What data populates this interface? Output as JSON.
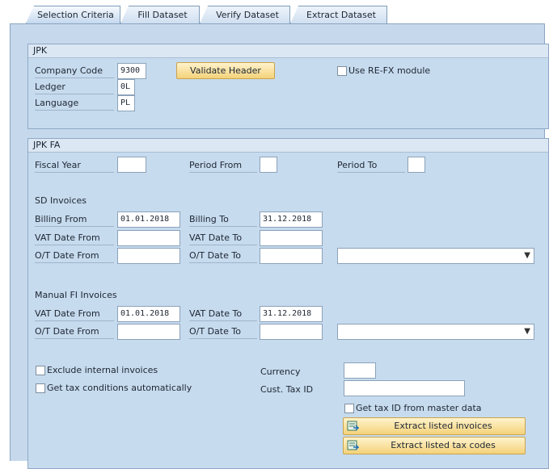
{
  "tabs": [
    "Selection Criteria",
    "Fill Dataset",
    "Verify Dataset",
    "Extract Dataset"
  ],
  "jpk": {
    "title": "JPK",
    "company_code_label": "Company Code",
    "company_code_value": "9300",
    "ledger_label": "Ledger",
    "ledger_value": "0L",
    "language_label": "Language",
    "language_value": "PL",
    "validate_button": "Validate Header",
    "use_refx_label": "Use RE-FX module"
  },
  "jpkfa": {
    "title": "JPK FA",
    "fiscal_year_label": "Fiscal Year",
    "fiscal_year_value": "",
    "period_from_label": "Period From",
    "period_from_value": "",
    "period_to_label": "Period To",
    "period_to_value": "",
    "sd": {
      "heading": "SD Invoices",
      "billing_from_label": "Billing From",
      "billing_from_value": "01.01.2018",
      "billing_to_label": "Billing To",
      "billing_to_value": "31.12.2018",
      "vat_from_label": "VAT Date From",
      "vat_from_value": "",
      "vat_to_label": "VAT Date To",
      "vat_to_value": "",
      "ot_from_label": "O/T Date From",
      "ot_from_value": "",
      "ot_to_label": "O/T Date To",
      "ot_to_value": "",
      "dropdown_value": ""
    },
    "fi": {
      "heading": "Manual FI Invoices",
      "vat_from_label": "VAT Date From",
      "vat_from_value": "01.01.2018",
      "vat_to_label": "VAT Date To",
      "vat_to_value": "31.12.2018",
      "ot_from_label": "O/T Date From",
      "ot_from_value": "",
      "ot_to_label": "O/T Date To",
      "ot_to_value": "",
      "dropdown_value": ""
    },
    "exclude_internal_label": "Exclude internal invoices",
    "get_tax_conditions_label": "Get tax conditions automatically",
    "currency_label": "Currency",
    "currency_value": "",
    "cust_tax_id_label": "Cust. Tax ID",
    "cust_tax_id_value": "",
    "get_tax_id_label": "Get tax ID from master data",
    "extract_invoices_button": "Extract listed invoices",
    "extract_tax_codes_button": "Extract listed tax codes"
  },
  "icons": {
    "dropdown": "chevron-down-icon",
    "extract": "extract-icon"
  }
}
